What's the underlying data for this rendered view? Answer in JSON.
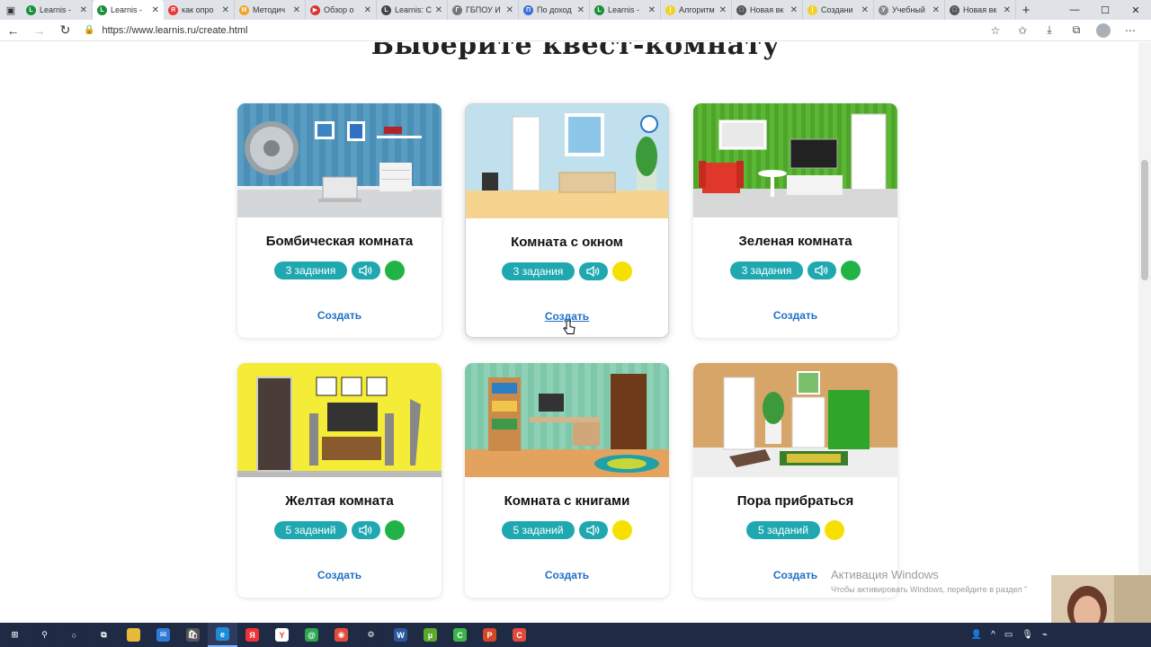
{
  "browser": {
    "tabs": [
      {
        "title": "Learnis -",
        "fav_color": "#1c8f3a",
        "fav_glyph": "L"
      },
      {
        "title": "Learnis - ",
        "fav_color": "#1c8f3a",
        "fav_glyph": "L",
        "active": true
      },
      {
        "title": "как опро",
        "fav_color": "#e33",
        "fav_glyph": "Я"
      },
      {
        "title": "Методич",
        "fav_color": "#f4a025",
        "fav_glyph": "М"
      },
      {
        "title": "Обзор о",
        "fav_color": "#d33",
        "fav_glyph": "▶"
      },
      {
        "title": "Learnis: С",
        "fav_color": "#444",
        "fav_glyph": "L"
      },
      {
        "title": "ГБПОУ И",
        "fav_color": "#777",
        "fav_glyph": "Г"
      },
      {
        "title": "По доход",
        "fav_color": "#3a6fd8",
        "fav_glyph": "П"
      },
      {
        "title": "Learnis -",
        "fav_color": "#1c8f3a",
        "fav_glyph": "L"
      },
      {
        "title": "Алгоритм",
        "fav_color": "#f2d027",
        "fav_glyph": "|"
      },
      {
        "title": "Новая вк",
        "fav_color": "#555",
        "fav_glyph": "□"
      },
      {
        "title": "Создани",
        "fav_color": "#f2d027",
        "fav_glyph": "|"
      },
      {
        "title": "Учебный",
        "fav_color": "#888",
        "fav_glyph": "У"
      },
      {
        "title": "Новая вк",
        "fav_color": "#555",
        "fav_glyph": "□"
      }
    ],
    "url": "https://www.learnis.ru/create.html"
  },
  "page": {
    "heading": "Выберите квест-комнату",
    "create_label": "Создать",
    "cards": [
      {
        "title": "Бомбическая комната",
        "tasks": "3 задания",
        "sound": true,
        "dot": "#22b347",
        "scene": "bomb"
      },
      {
        "title": "Комната с окном",
        "tasks": "3 задания",
        "sound": true,
        "dot": "#f5e000",
        "scene": "window"
      },
      {
        "title": "Зеленая комната",
        "tasks": "3 задания",
        "sound": true,
        "dot": "#22b347",
        "scene": "green"
      },
      {
        "title": "Желтая комната",
        "tasks": "5 заданий",
        "sound": true,
        "dot": "#22b347",
        "scene": "yellow"
      },
      {
        "title": "Комната с книгами",
        "tasks": "5 заданий",
        "sound": true,
        "dot": "#f5e000",
        "scene": "books"
      },
      {
        "title": "Пора прибраться",
        "tasks": "5 заданий",
        "sound": false,
        "dot": "#f5e000",
        "scene": "tidy"
      }
    ]
  },
  "watermark": {
    "title": "Активация Windows",
    "subtitle": "Чтобы активировать Windows, перейдите в раздел \""
  },
  "taskbar": {
    "apps": [
      {
        "name": "start",
        "color": "#1f2a44",
        "glyph": "⊞"
      },
      {
        "name": "search",
        "color": "#1f2a44",
        "glyph": "⚲"
      },
      {
        "name": "cortana",
        "color": "#1f2a44",
        "glyph": "○"
      },
      {
        "name": "taskview",
        "color": "#1f2a44",
        "glyph": "⧉"
      },
      {
        "name": "explorer",
        "color": "#e8b93a",
        "glyph": ""
      },
      {
        "name": "mail",
        "color": "#2f7ad8",
        "glyph": "✉"
      },
      {
        "name": "store",
        "color": "#555",
        "glyph": "🛍"
      },
      {
        "name": "edge",
        "color": "#1d8ad8",
        "glyph": "e"
      },
      {
        "name": "yandex",
        "color": "#e33",
        "glyph": "Я"
      },
      {
        "name": "yandex-browser",
        "color": "#fff",
        "glyph": "Y"
      },
      {
        "name": "whatsapp-like",
        "color": "#2ea44f",
        "glyph": "@"
      },
      {
        "name": "chrome",
        "color": "#e24c3a",
        "glyph": "◉"
      },
      {
        "name": "settings",
        "color": "#1f2a44",
        "glyph": "⚙"
      },
      {
        "name": "word",
        "color": "#2b579a",
        "glyph": "W"
      },
      {
        "name": "utorrent",
        "color": "#5aa92a",
        "glyph": "µ"
      },
      {
        "name": "camtasia",
        "color": "#3bb54a",
        "glyph": "C"
      },
      {
        "name": "powerpoint",
        "color": "#d24726",
        "glyph": "P"
      },
      {
        "name": "recorder",
        "color": "#e04a3a",
        "glyph": "C"
      }
    ]
  }
}
